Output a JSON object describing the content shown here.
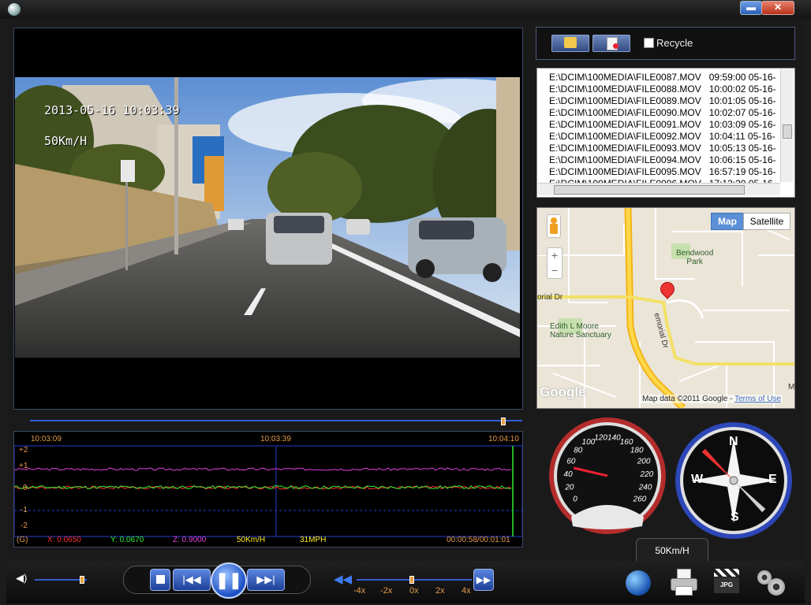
{
  "window": {
    "minimize_label": "▬",
    "close_label": "✕"
  },
  "video": {
    "date_time": "2013-05-16  10:03:39",
    "speed_overlay": "50Km/H"
  },
  "graph": {
    "time_start": "10:03:09",
    "time_mid": "10:03:39",
    "time_end": "10:04:10",
    "y_ticks": [
      "+2",
      "+1",
      "0",
      "-1",
      "-2"
    ],
    "unit": "(G)",
    "x_value": "X: 0.0650",
    "y_value": "Y: 0.0670",
    "z_value": "Z: 0.9000",
    "speed_kmh": "50Km/H",
    "speed_mph": "31MPH",
    "elapsed": "00:00:58/00:01:01",
    "colors": {
      "x": "#ff3030",
      "y": "#33ee33",
      "z": "#e040e0",
      "speed": "#ffee22",
      "time": "#e39a4c"
    }
  },
  "toolbar": {
    "open_icon": "folder-search-icon",
    "delete_icon": "delete-file-icon",
    "recycle_label": "Recycle",
    "recycle_checked": false
  },
  "files": [
    {
      "path": "E:\\DCIM\\100MEDIA\\FILE0087.MOV",
      "time": "09:59:00 05-16-"
    },
    {
      "path": "E:\\DCIM\\100MEDIA\\FILE0088.MOV",
      "time": "10:00:02 05-16-"
    },
    {
      "path": "E:\\DCIM\\100MEDIA\\FILE0089.MOV",
      "time": "10:01:05 05-16-"
    },
    {
      "path": "E:\\DCIM\\100MEDIA\\FILE0090.MOV",
      "time": "10:02:07 05-16-"
    },
    {
      "path": "E:\\DCIM\\100MEDIA\\FILE0091.MOV",
      "time": "10:03:09 05-16-"
    },
    {
      "path": "E:\\DCIM\\100MEDIA\\FILE0092.MOV",
      "time": "10:04:11 05-16-"
    },
    {
      "path": "E:\\DCIM\\100MEDIA\\FILE0093.MOV",
      "time": "10:05:13 05-16-"
    },
    {
      "path": "E:\\DCIM\\100MEDIA\\FILE0094.MOV",
      "time": "10:06:15 05-16-"
    },
    {
      "path": "E:\\DCIM\\100MEDIA\\FILE0095.MOV",
      "time": "16:57:19 05-16-"
    },
    {
      "path": "E:\\DCIM\\100MEDIA\\FILE0096.MOV",
      "time": "17:12:20 05-16-"
    }
  ],
  "map": {
    "map_tab": "Map",
    "satellite_tab": "Satellite",
    "zoom_in": "+",
    "zoom_out": "−",
    "park_label": "Bendwood\nPark",
    "street_left": "orial Dr",
    "street_right": "emorial Dr",
    "sanctuary_label": "Edith L Moore\nNature Sanctuary",
    "google_logo": "Google",
    "attribution": "Map data ©2011 Google - ",
    "terms_link": "Terms of Use",
    "edge_letter": "M"
  },
  "speedometer": {
    "ticks": [
      "0",
      "20",
      "40",
      "60",
      "80",
      "100",
      "120",
      "140",
      "160",
      "180",
      "200",
      "220",
      "240",
      "260"
    ],
    "value_kmh": 50
  },
  "compass": {
    "n": "N",
    "e": "E",
    "s": "S",
    "w": "W",
    "heading_deg": 135
  },
  "speed_readout": "50Km/H",
  "controls": {
    "volume_level": 0.9,
    "speed_labels": [
      "-4x",
      "-2x",
      "0x",
      "2x",
      "4x"
    ],
    "playback_speed_index": 2
  },
  "bottom_icons": [
    "google-earth-icon",
    "print-icon",
    "jpg-snapshot-icon",
    "settings-icon"
  ]
}
